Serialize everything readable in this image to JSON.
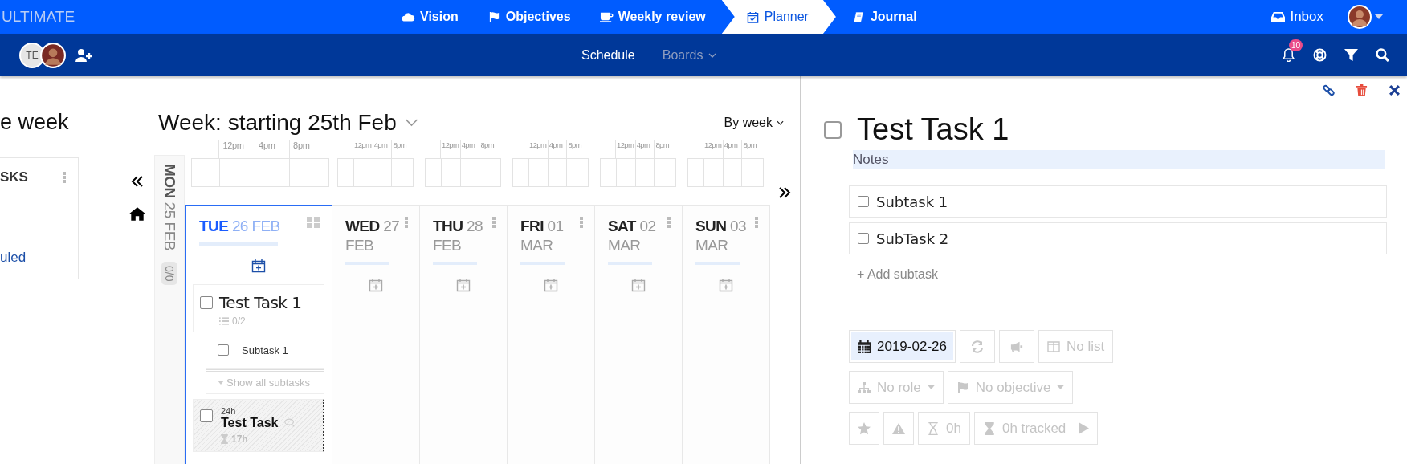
{
  "app": {
    "title": "ULTIMATE"
  },
  "nav": [
    {
      "label": "Vision",
      "selected": false
    },
    {
      "label": "Objectives",
      "selected": false
    },
    {
      "label": "Weekly review",
      "selected": false
    },
    {
      "label": "Planner",
      "selected": true
    },
    {
      "label": "Journal",
      "selected": false
    }
  ],
  "inbox": {
    "label": "Inbox"
  },
  "team": {
    "initials": "TE"
  },
  "views": [
    {
      "label": "Schedule",
      "selected": true
    },
    {
      "label": "Boards",
      "selected": false
    }
  ],
  "notifications": {
    "count": "10"
  },
  "left_panel": {
    "heading": "e week",
    "card_title": "SKS",
    "link": "uled"
  },
  "week": {
    "title": "Week: starting 25th Feb",
    "mode": "By week"
  },
  "collapsed_day": {
    "weekday": "MON",
    "date": "25 FEB",
    "count": "0/0"
  },
  "timelines": [
    {
      "hours": [
        "12pm",
        "4pm",
        "8pm"
      ]
    },
    {
      "hours": [
        "12pm",
        "4pm",
        "8pm"
      ]
    },
    {
      "hours": [
        "12pm",
        "4pm",
        "8pm"
      ]
    },
    {
      "hours": [
        "12pm",
        "4pm",
        "8pm"
      ]
    },
    {
      "hours": [
        "12pm",
        "4pm",
        "8pm"
      ]
    },
    {
      "hours": [
        "12pm",
        "4pm",
        "8pm"
      ]
    }
  ],
  "days": [
    {
      "weekday": "TUE",
      "date": "26 FEB",
      "selected": true,
      "tasks": [
        {
          "kind": "task",
          "title": "Test Task 1",
          "checked": false,
          "subtask_count": "0/2",
          "subtasks": [
            {
              "title": "Subtask 1",
              "checked": false
            }
          ],
          "show_all": "Show all subtasks"
        },
        {
          "kind": "timed",
          "duration": "24h",
          "title": "Test Task",
          "checked": false,
          "tracked": "17h"
        }
      ]
    },
    {
      "weekday": "WED",
      "date": "27 FEB",
      "selected": false
    },
    {
      "weekday": "THU",
      "date": "28 FEB",
      "selected": false
    },
    {
      "weekday": "FRI",
      "date": "01 MAR",
      "selected": false
    },
    {
      "weekday": "SAT",
      "date": "02 MAR",
      "selected": false
    },
    {
      "weekday": "SUN",
      "date": "03 MAR",
      "selected": false
    }
  ],
  "detail": {
    "title": "Test Task 1",
    "checked": false,
    "notes": {
      "placeholder": "Notes"
    },
    "subtasks": [
      {
        "title": "Subtask 1",
        "checked": false
      },
      {
        "title": "SubTask 2",
        "checked": false
      }
    ],
    "add_subtask": "+ Add subtask",
    "date": "2019-02-26",
    "list": "No list",
    "role": "No role",
    "objective": "No objective",
    "estimate": "0h",
    "tracked": "0h tracked"
  }
}
